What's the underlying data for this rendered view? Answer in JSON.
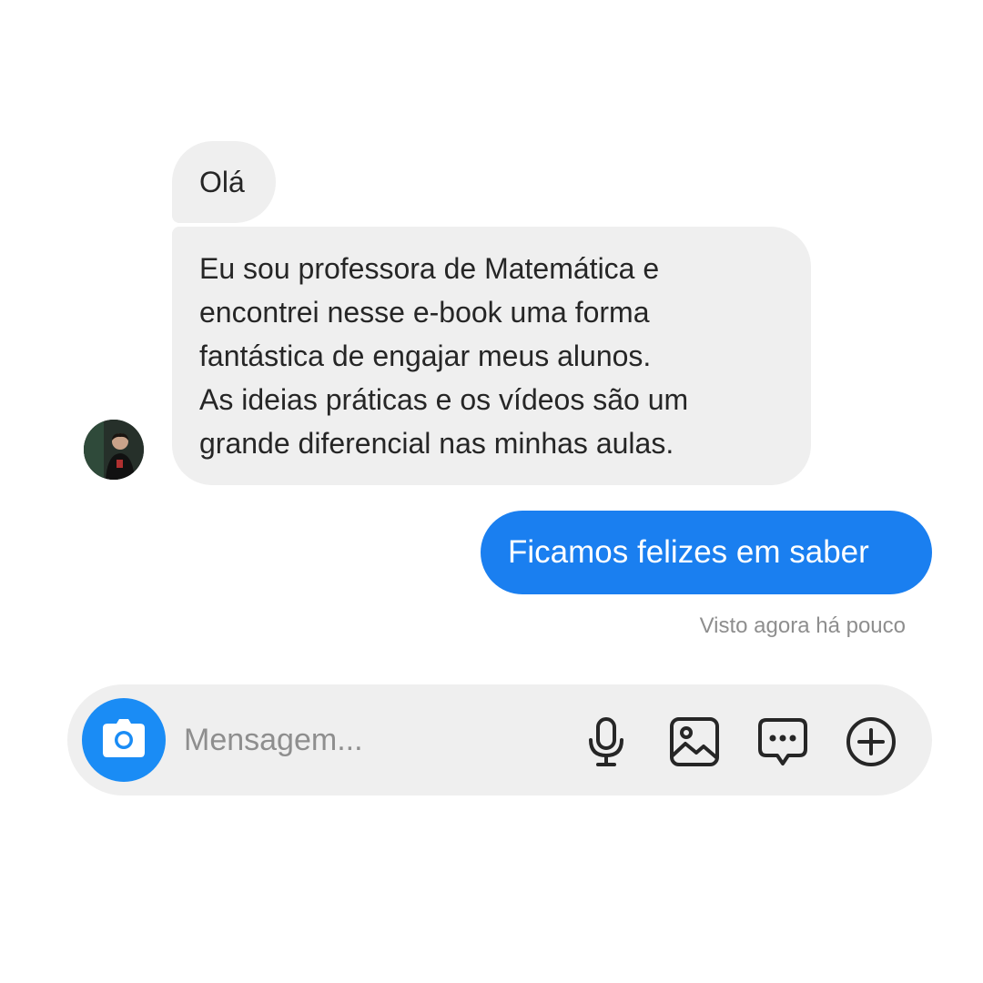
{
  "conversation": {
    "incoming": [
      {
        "text": "Olá"
      },
      {
        "text": "Eu sou professora de Matemática e\nencontrei nesse e-book uma forma\nfantástica de engajar meus alunos.\nAs ideias práticas e os vídeos são um\ngrande diferencial nas minhas aulas."
      }
    ],
    "outgoing": [
      {
        "text": "Ficamos felizes em saber"
      }
    ],
    "seen_status": "Visto agora há pouco"
  },
  "composer": {
    "placeholder": "Mensagem...",
    "icons": [
      "camera-icon",
      "microphone-icon",
      "gallery-icon",
      "sticker-icon",
      "plus-icon"
    ]
  },
  "colors": {
    "incoming_bubble": "#efefef",
    "outgoing_bubble": "#1a7ff0",
    "camera_button": "#1a8cf5",
    "muted_text": "#8e8e8e"
  }
}
